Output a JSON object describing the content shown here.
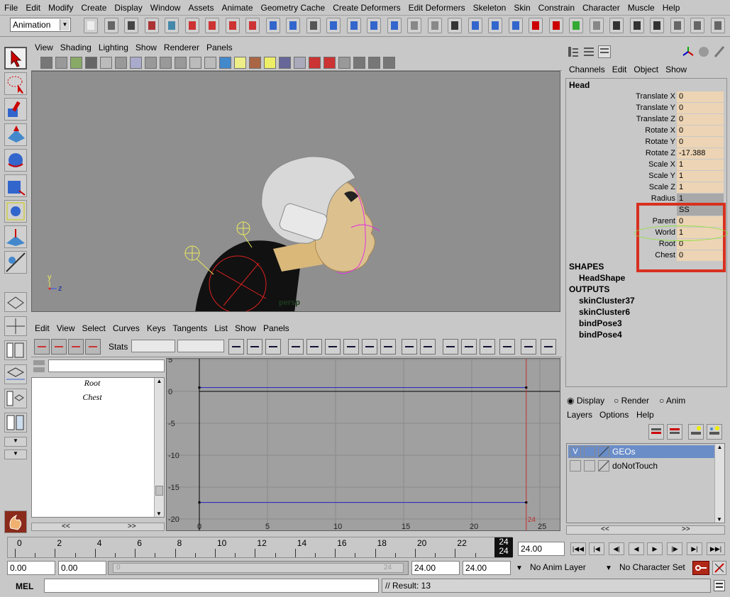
{
  "menubar": [
    "File",
    "Edit",
    "Modify",
    "Create",
    "Display",
    "Window",
    "Assets",
    "Animate",
    "Geometry Cache",
    "Create Deformers",
    "Edit Deformers",
    "Skeleton",
    "Skin",
    "Constrain",
    "Character",
    "Muscle",
    "Help"
  ],
  "mode_select": {
    "value": "Animation"
  },
  "viewport": {
    "menu": [
      "View",
      "Shading",
      "Lighting",
      "Show",
      "Renderer",
      "Panels"
    ],
    "camera_label": "persp",
    "axis_y": "y",
    "axis_z": "z"
  },
  "graph_editor": {
    "menu": [
      "Edit",
      "View",
      "Select",
      "Curves",
      "Keys",
      "Tangents",
      "List",
      "Show",
      "Panels"
    ],
    "stats_label": "Stats",
    "outliner_items": [
      "Root",
      "Chest"
    ],
    "scroll_left": "<<",
    "scroll_right": ">>",
    "y_ticks": [
      "5",
      "0",
      "-5",
      "-10",
      "-15",
      "-20"
    ],
    "x_ticks": [
      "0",
      "5",
      "10",
      "15",
      "20",
      "25"
    ],
    "end_marker": "24"
  },
  "channel_box": {
    "menu": [
      "Channels",
      "Edit",
      "Object",
      "Show"
    ],
    "node": "Head",
    "attributes": [
      {
        "label": "Translate X",
        "value": "0"
      },
      {
        "label": "Translate Y",
        "value": "0"
      },
      {
        "label": "Translate Z",
        "value": "0"
      },
      {
        "label": "Rotate X",
        "value": "0"
      },
      {
        "label": "Rotate Y",
        "value": "0"
      },
      {
        "label": "Rotate Z",
        "value": "-17.388"
      },
      {
        "label": "Scale X",
        "value": "1"
      },
      {
        "label": "Scale Y",
        "value": "1"
      },
      {
        "label": "Scale Z",
        "value": "1"
      },
      {
        "label": "Radius",
        "value": "1"
      },
      {
        "label": "",
        "value": "SS"
      },
      {
        "label": "Parent",
        "value": "0"
      },
      {
        "label": "World",
        "value": "1"
      },
      {
        "label": "Root",
        "value": "0"
      },
      {
        "label": "Chest",
        "value": "0"
      }
    ],
    "shapes_title": "SHAPES",
    "shapes": [
      "HeadShape"
    ],
    "outputs_title": "OUTPUTS",
    "outputs": [
      "skinCluster37",
      "skinCluster6",
      "bindPose3",
      "bindPose4"
    ]
  },
  "layer_editor": {
    "radios": [
      "Display",
      "Render",
      "Anim"
    ],
    "menu": [
      "Layers",
      "Options",
      "Help"
    ],
    "layers": [
      {
        "v": "V",
        "name": "GEOs"
      },
      {
        "v": "",
        "name": "doNotTouch"
      }
    ],
    "scroll_left": "<<",
    "scroll_right": ">>"
  },
  "timeline": {
    "ticks": [
      "0",
      "2",
      "4",
      "6",
      "8",
      "10",
      "12",
      "14",
      "16",
      "18",
      "20",
      "22"
    ],
    "current_frame_top": "24",
    "current_frame_bottom": "24",
    "current_time": "24.00"
  },
  "range": {
    "start_time": "0.00",
    "playback_start": "0.00",
    "slider_left": "0",
    "slider_right": "24",
    "playback_end": "24.00",
    "end_time": "24.00",
    "anim_layer": "No Anim Layer",
    "character_set": "No Character Set"
  },
  "command_line": {
    "label": "MEL",
    "result": "// Result: 13"
  }
}
